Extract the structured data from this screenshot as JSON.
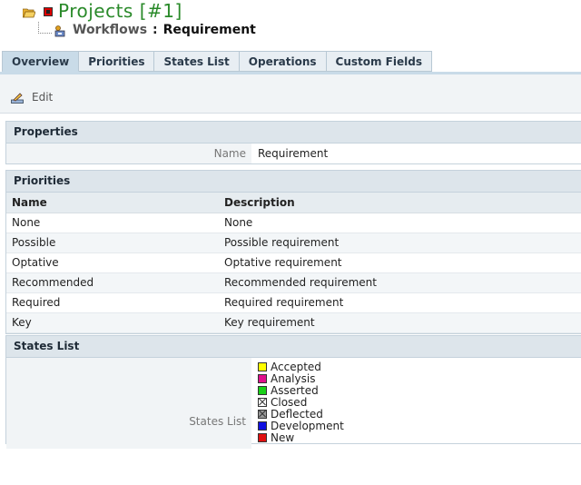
{
  "header": {
    "project_title": "Projects [#1]",
    "workflows_label": "Workflows",
    "separator": ":",
    "current_item": "Requirement"
  },
  "tabs": [
    {
      "label": "Overview",
      "active": true
    },
    {
      "label": "Priorities",
      "active": false
    },
    {
      "label": "States List",
      "active": false
    },
    {
      "label": "Operations",
      "active": false
    },
    {
      "label": "Custom Fields",
      "active": false
    }
  ],
  "toolbar": {
    "edit_label": "Edit"
  },
  "properties": {
    "title": "Properties",
    "name_label": "Name",
    "name_value": "Requirement"
  },
  "priorities": {
    "title": "Priorities",
    "columns": [
      "Name",
      "Description"
    ],
    "rows": [
      [
        "None",
        "None"
      ],
      [
        "Possible",
        "Possible requirement"
      ],
      [
        "Optative",
        "Optative requirement"
      ],
      [
        "Recommended",
        "Recommended requirement"
      ],
      [
        "Required",
        "Required requirement"
      ],
      [
        "Key",
        "Key requirement"
      ]
    ]
  },
  "states": {
    "title": "States List",
    "label": "States List",
    "items": [
      {
        "name": "Accepted",
        "color": "#ffff00",
        "crossed": false
      },
      {
        "name": "Analysis",
        "color": "#e0108c",
        "crossed": false
      },
      {
        "name": "Asserted",
        "color": "#18d018",
        "crossed": false
      },
      {
        "name": "Closed",
        "color": "#ffffff",
        "crossed": true
      },
      {
        "name": "Deflected",
        "color": "#9a9a9a",
        "crossed": true
      },
      {
        "name": "Development",
        "color": "#1010e0",
        "crossed": false
      },
      {
        "name": "New",
        "color": "#e01010",
        "crossed": false
      }
    ]
  },
  "colors": {
    "accent_green": "#2a8a2a",
    "tab_active": "#c9dbe8",
    "section_header": "#dde5eb"
  }
}
